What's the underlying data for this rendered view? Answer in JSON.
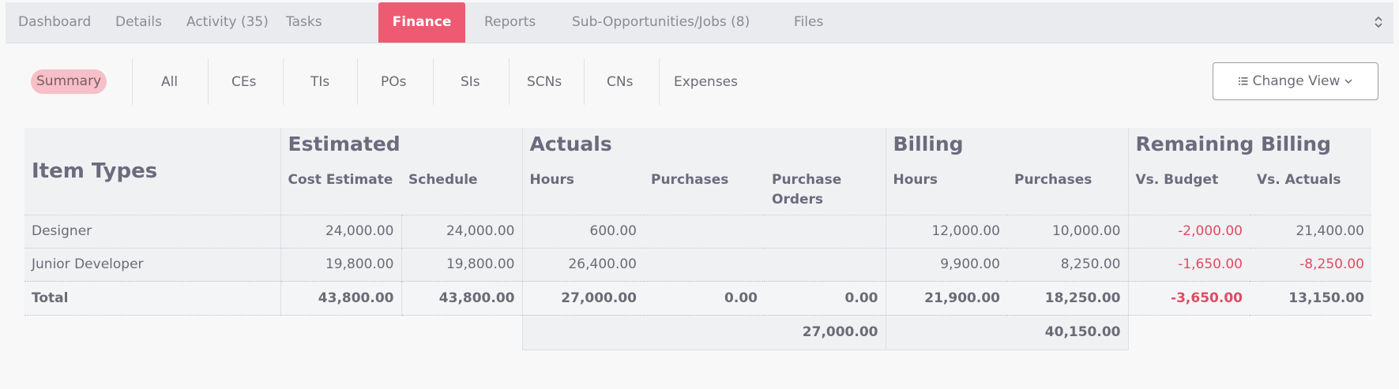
{
  "tabs": [
    {
      "label": "Dashboard"
    },
    {
      "label": "Details"
    },
    {
      "label": "Activity (35)"
    },
    {
      "label": "Tasks"
    },
    {
      "label": "Finance"
    },
    {
      "label": "Reports"
    },
    {
      "label": "Sub-Opportunities/Jobs (8)"
    },
    {
      "label": "Files"
    }
  ],
  "active_tab": "Finance",
  "subtabs": [
    {
      "label": "Summary"
    },
    {
      "label": "All"
    },
    {
      "label": "CEs"
    },
    {
      "label": "TIs"
    },
    {
      "label": "POs"
    },
    {
      "label": "SIs"
    },
    {
      "label": "SCNs"
    },
    {
      "label": "CNs"
    },
    {
      "label": "Expenses"
    }
  ],
  "change_view_label": "Change View",
  "table": {
    "item_types_label": "Item Types",
    "groups": {
      "estimated": "Estimated",
      "actuals": "Actuals",
      "billing": "Billing",
      "remaining": "Remaining Billing"
    },
    "columns": {
      "cost_estimate": "Cost Estimate",
      "schedule": "Schedule",
      "act_hours": "Hours",
      "act_purchases": "Purchases",
      "act_po": "Purchase Orders",
      "bill_hours": "Hours",
      "bill_purchases": "Purchases",
      "vs_budget": "Vs. Budget",
      "vs_actuals": "Vs. Actuals"
    },
    "rows": [
      {
        "type": "Designer",
        "cost_estimate": "24,000.00",
        "schedule": "24,000.00",
        "act_hours": "600.00",
        "act_purchases": "",
        "act_po": "",
        "bill_hours": "12,000.00",
        "bill_purchases": "10,000.00",
        "vs_budget": "-2,000.00",
        "vs_actuals": "21,400.00"
      },
      {
        "type": "Junior Developer",
        "cost_estimate": "19,800.00",
        "schedule": "19,800.00",
        "act_hours": "26,400.00",
        "act_purchases": "",
        "act_po": "",
        "bill_hours": "9,900.00",
        "bill_purchases": "8,250.00",
        "vs_budget": "-1,650.00",
        "vs_actuals": "-8,250.00"
      }
    ],
    "total": {
      "type": "Total",
      "cost_estimate": "43,800.00",
      "schedule": "43,800.00",
      "act_hours": "27,000.00",
      "act_purchases": "0.00",
      "act_po": "0.00",
      "bill_hours": "21,900.00",
      "bill_purchases": "18,250.00",
      "vs_budget": "-3,650.00",
      "vs_actuals": "13,150.00"
    },
    "grand": {
      "actuals": "27,000.00",
      "billing": "40,150.00"
    }
  },
  "colors": {
    "accent": "#ee5a72",
    "negative": "#e04b63"
  }
}
